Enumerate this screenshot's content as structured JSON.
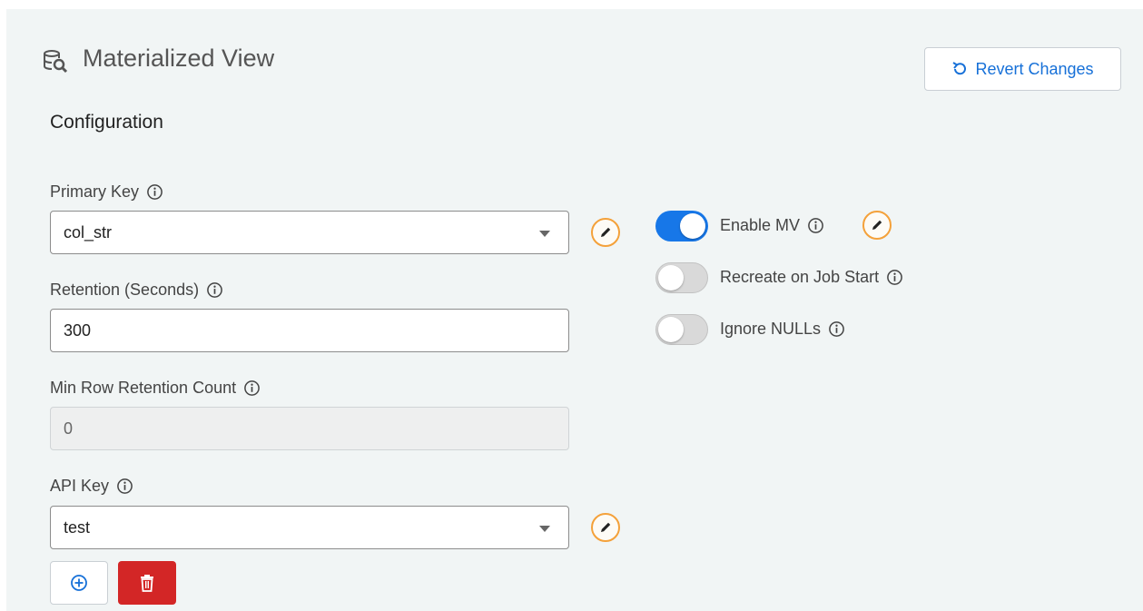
{
  "header": {
    "title": "Materialized View",
    "revert_label": "Revert Changes"
  },
  "section_title": "Configuration",
  "fields": {
    "primary_key": {
      "label": "Primary Key",
      "value": "col_str"
    },
    "retention": {
      "label": "Retention (Seconds)",
      "value": "300"
    },
    "min_row": {
      "label": "Min Row Retention Count",
      "value": "0"
    },
    "api_key": {
      "label": "API Key",
      "value": "test"
    }
  },
  "toggles": {
    "enable_mv": {
      "label": "Enable MV",
      "on": true
    },
    "recreate": {
      "label": "Recreate on Job Start",
      "on": false
    },
    "ignore_nulls": {
      "label": "Ignore NULLs",
      "on": false
    }
  },
  "colors": {
    "accent": "#1670d8",
    "toggle_on": "#1777e8",
    "edit_ring": "#f4a13a",
    "delete": "#d32626"
  },
  "icons": {
    "title": "database-search-icon",
    "revert": "undo-icon",
    "edit": "pencil-icon",
    "info": "info-icon",
    "add": "plus-circle-icon",
    "delete": "trash-icon",
    "dropdown": "caret-down-icon"
  }
}
